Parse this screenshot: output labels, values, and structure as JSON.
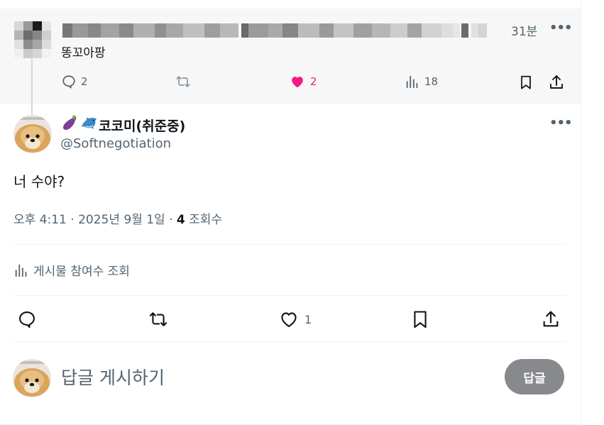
{
  "parent_post": {
    "time": "31분",
    "more": "•••",
    "text": "똥꼬아팡",
    "replies": "2",
    "reposts": "",
    "likes": "2",
    "views": "18"
  },
  "post": {
    "emojis": [
      "🍆",
      "🐬"
    ],
    "display_name": "코코미(취준중)",
    "handle": "@Softnegotiation",
    "more": "•••",
    "text": "너 수야?",
    "timestamp": "오후 4:11 · 2025년 9월 1일 · ",
    "views_count": "4",
    "views_label": " 조회수",
    "engagement_label": "게시물 참여수 조회",
    "likes": "1"
  },
  "reply": {
    "placeholder": "답글 게시하기",
    "button_label": "답글"
  },
  "colors": {
    "like_active": "#f91880",
    "secondary_text": "#536471",
    "reply_button": "#87898c"
  }
}
